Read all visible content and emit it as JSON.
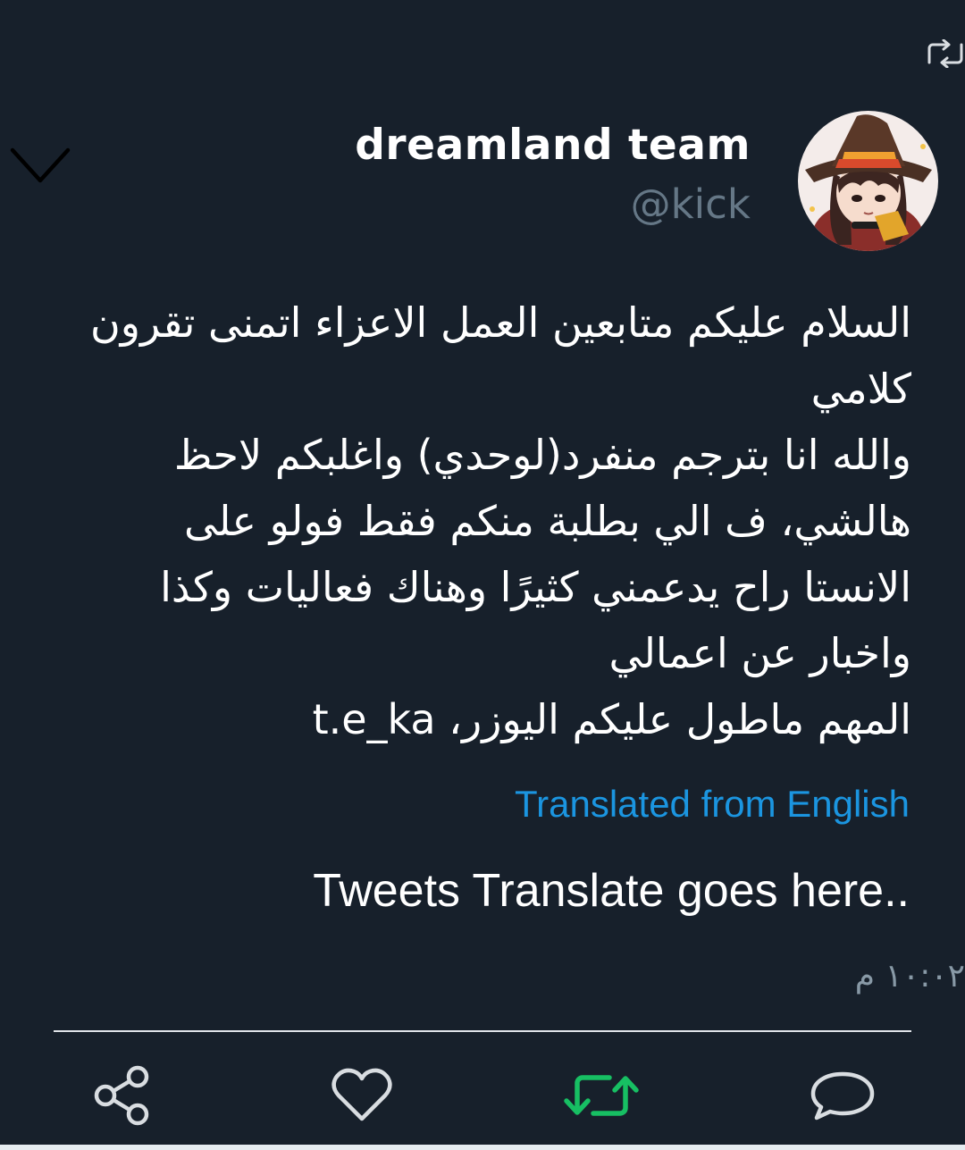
{
  "tweet": {
    "display_name": "dreamland team",
    "handle": "@kick",
    "body": "السلام عليكم متابعين العمل الاعزاء اتمنى تقرون كلامي\nوالله انا بترجم منفرد(لوحدي) واغلبكم لاحظ هالشي، ف الي بطلبة منكم فقط فولو على الانستا راح يدعمني كثيرًا وهناك فعاليات وكذا واخبار عن اعمالي\nالمهم ماطول عليكم اليوزر، t.e_ka",
    "translated_label": "Translated from English",
    "translated_text": "Tweets Translate goes here..",
    "timestamp": "١٠:٠٢ م"
  },
  "icons": {
    "retweet_indicator": "retweet-icon",
    "menu": "chevron-down-icon",
    "avatar": "anime-witch-avatar",
    "share": "share-icon",
    "like": "heart-icon",
    "retweet": "retweet-icon",
    "reply": "reply-bubble-icon"
  },
  "colors": {
    "background": "#17202b",
    "text": "#ffffff",
    "muted": "#657786",
    "link": "#1b95e0",
    "retweet_active": "#17bf63",
    "icon": "#d9dde1"
  }
}
